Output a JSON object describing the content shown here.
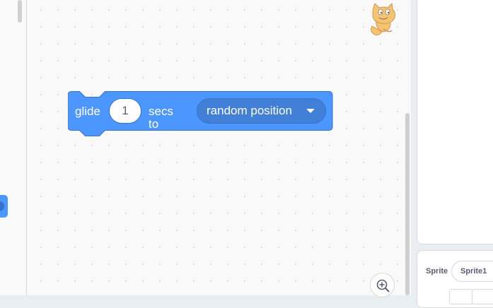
{
  "block": {
    "label_before": "glide",
    "secs_value": "1",
    "label_middle": "secs to",
    "target_selected": "random position",
    "color": "#4c97ff"
  },
  "sprite_panel": {
    "label": "Sprite",
    "sprite_name": "Sprite1"
  },
  "icons": {
    "sprite_thumbnail": "scratch-cat-icon",
    "zoom_in": "zoom-in-icon",
    "dropdown": "dropdown-arrow-icon"
  }
}
